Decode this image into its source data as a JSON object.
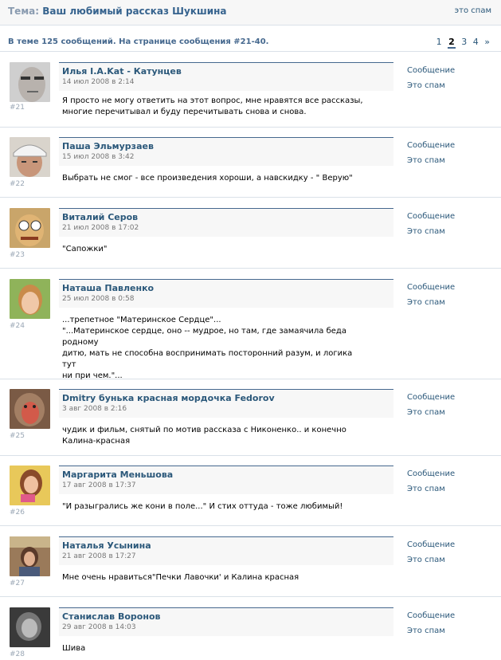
{
  "header": {
    "prefix": "Тема:",
    "topic": "Ваш любимый рассказ Шукшина",
    "spam": "это спам"
  },
  "info": {
    "text": "В теме 125 сообщений. На странице сообщения #21-40.",
    "pages": [
      "1",
      "2",
      "3",
      "4",
      "»"
    ],
    "current_page": "2"
  },
  "actions": {
    "message": "Сообщение",
    "spam": "Это спам"
  },
  "posts": [
    {
      "author": "Илья I.A.Kat - Катунцев",
      "date": "14 июл 2008 в 2:14",
      "number": "#21",
      "text": "Я просто не могу ответить на этот вопрос, мне нравятся все рассказы, многие перечитывал и буду перечитывать снова и снова."
    },
    {
      "author": "Паша Эльмурзаев",
      "date": "15 июл 2008 в 3:42",
      "number": "#22",
      "text": "Выбрать не смог - все произведения хороши, а навскидку - \" Верую\""
    },
    {
      "author": "Виталий Серов",
      "date": "21 июл 2008 в 17:02",
      "number": "#23",
      "text": "\"Сапожки\""
    },
    {
      "author": "Наташа Павленко",
      "date": "25 июл 2008 в 0:58",
      "number": "#24",
      "text": "...трепетное \"Материнское Сердце\"...\n\"...Материнское сердце, оно -- мудрое, но там, где замаячила беда родному\nдитю, мать не способна воспринимать посторонний разум, и логика тут\nни при чем.\"..."
    },
    {
      "author": "Dmitry бунька красная мордочка Fedorov",
      "date": "3 авг 2008 в 2:16",
      "number": "#25",
      "text": "чудик и фильм, снятый по мотив рассказа с Никоненко.. и конечно\nКалина-красная"
    },
    {
      "author": "Маргарита Меньшова",
      "date": "17 авг 2008 в 17:37",
      "number": "#26",
      "text": "\"И разыгрались же кони в поле...\" И стих оттуда - тоже любимый!"
    },
    {
      "author": "Наталья Усынина",
      "date": "21 авг 2008 в 17:27",
      "number": "#27",
      "text": "Мне очень нравиться\"Печки Лавочки' и Калина красная"
    },
    {
      "author": "Станислав Воронов",
      "date": "29 авг 2008 в 14:03",
      "number": "#28",
      "text": "Шива"
    }
  ]
}
